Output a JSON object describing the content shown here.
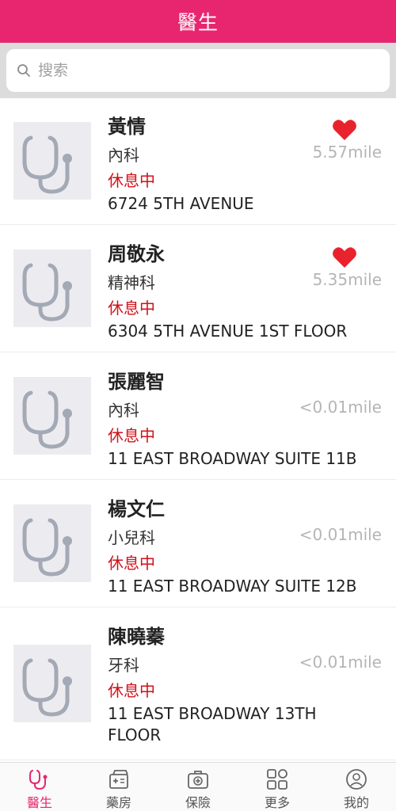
{
  "header": {
    "title": "醫生"
  },
  "search": {
    "placeholder": "搜索",
    "value": ""
  },
  "doctors": [
    {
      "name": "黃情",
      "dept": "內科",
      "status": "休息中",
      "address": "6724 5TH AVENUE",
      "distance": "5.57mile",
      "favorite": true
    },
    {
      "name": "周敬永",
      "dept": "精神科",
      "status": "休息中",
      "address": "6304 5TH AVENUE 1ST FLOOR",
      "distance": "5.35mile",
      "favorite": true
    },
    {
      "name": "張麗智",
      "dept": "內科",
      "status": "休息中",
      "address": "11 EAST BROADWAY SUITE 11B",
      "distance": "<0.01mile",
      "favorite": false
    },
    {
      "name": "楊文仁",
      "dept": "小兒科",
      "status": "休息中",
      "address": "11 EAST BROADWAY SUITE 12B",
      "distance": "<0.01mile",
      "favorite": false
    },
    {
      "name": "陳曉蓁",
      "dept": "牙科",
      "status": "休息中",
      "address": "11 EAST BROADWAY 13TH FLOOR",
      "distance": "<0.01mile",
      "favorite": false
    }
  ],
  "tabs": [
    {
      "label": "醫生",
      "icon": "stethoscope-icon",
      "active": true
    },
    {
      "label": "藥房",
      "icon": "pharmacy-icon",
      "active": false
    },
    {
      "label": "保險",
      "icon": "insurance-icon",
      "active": false
    },
    {
      "label": "更多",
      "icon": "grid-icon",
      "active": false
    },
    {
      "label": "我的",
      "icon": "profile-icon",
      "active": false
    }
  ],
  "colors": {
    "brand": "#e8266f",
    "status": "#d0111a",
    "heart": "#e8232d",
    "distance": "#b5b5b5"
  }
}
